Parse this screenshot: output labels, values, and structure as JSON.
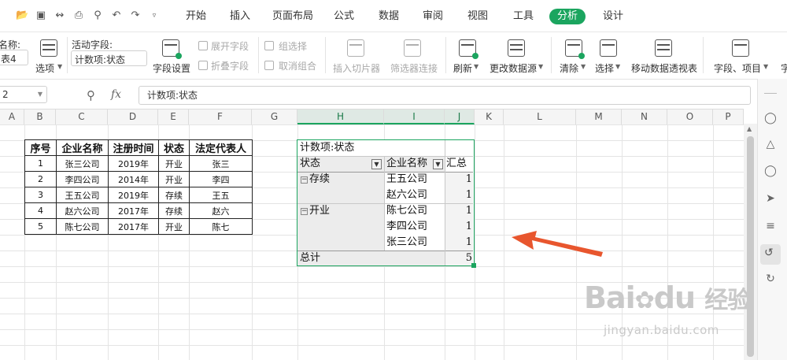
{
  "toolbar": {
    "quick_icons": [
      "folder-icon",
      "save-icon",
      "format-painter-icon",
      "print-icon",
      "print-preview-icon",
      "undo-icon",
      "redo-icon",
      "more-icon"
    ],
    "menu": [
      "开始",
      "插入",
      "页面布局",
      "公式",
      "数据",
      "审阅",
      "视图",
      "工具",
      "分析",
      "设计"
    ],
    "active_menu": "分析"
  },
  "ribbon": {
    "name_label": "名称:",
    "name_value": "表4",
    "options_label": "选项",
    "active_field_label": "活动字段:",
    "active_field_value": "计数项:状态",
    "field_settings": "字段设置",
    "expand_field": "展开字段",
    "collapse_field": "折叠字段",
    "group_selection": "组选择",
    "ungroup": "取消组合",
    "insert_slicer": "插入切片器",
    "filter_connection": "筛选器连接",
    "refresh": "刷新",
    "change_source": "更改数据源",
    "clear": "清除",
    "select": "选择",
    "move_pivot": "移动数据透视表",
    "fields_items": "字段、项目",
    "truncated": "字"
  },
  "formula_bar": {
    "cell_ref": "2",
    "fx": "fx",
    "value": "计数项:状态"
  },
  "columns": [
    "A",
    "B",
    "C",
    "D",
    "E",
    "F",
    "G",
    "H",
    "I",
    "J",
    "K",
    "L",
    "M",
    "N",
    "O",
    "P"
  ],
  "data_table": {
    "headers": [
      "序号",
      "企业名称",
      "注册时间",
      "状态",
      "法定代表人"
    ],
    "rows": [
      [
        "1",
        "张三公司",
        "2019年",
        "开业",
        "张三"
      ],
      [
        "2",
        "李四公司",
        "2014年",
        "开业",
        "李四"
      ],
      [
        "3",
        "王五公司",
        "2019年",
        "存续",
        "王五"
      ],
      [
        "4",
        "赵六公司",
        "2017年",
        "存续",
        "赵六"
      ],
      [
        "5",
        "陈七公司",
        "2017年",
        "开业",
        "陈七"
      ]
    ]
  },
  "pivot": {
    "title": "计数项:状态",
    "header_status": "状态",
    "header_company": "企业名称",
    "header_total": "汇总",
    "groups": [
      {
        "name": "存续",
        "items": [
          {
            "company": "王五公司",
            "count": "1"
          },
          {
            "company": "赵六公司",
            "count": "1"
          }
        ]
      },
      {
        "name": "开业",
        "items": [
          {
            "company": "陈七公司",
            "count": "1"
          },
          {
            "company": "李四公司",
            "count": "1"
          },
          {
            "company": "张三公司",
            "count": "1"
          }
        ]
      }
    ],
    "grand_total_label": "总计",
    "grand_total": "5"
  },
  "annotation": {
    "arrow_color": "#e8562e"
  },
  "watermark": {
    "brand": "Bai",
    "brand2": "du",
    "cn": "经验",
    "url": "jingyan.baidu.com"
  },
  "colors": {
    "accent": "#1ba55f"
  }
}
